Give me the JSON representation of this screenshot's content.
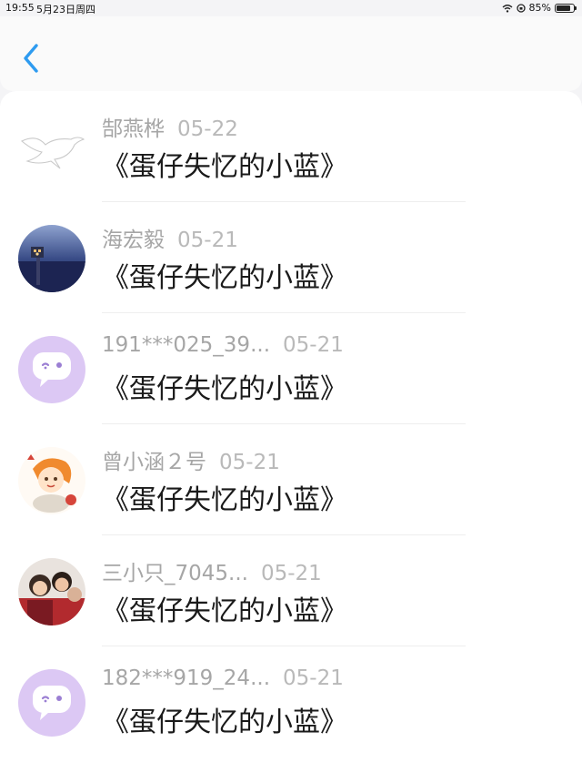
{
  "status_bar": {
    "time": "19:55",
    "date": "5月23日周四",
    "battery": "85%",
    "battery_level": 0.85
  },
  "header": {
    "back_icon": "chevron-left-icon"
  },
  "accent_color": "#2e9bf0",
  "items": [
    {
      "name": "郜燕桦",
      "date": "05-22",
      "message": "《蛋仔失忆的小蓝》",
      "avatar": "bird-outline-avatar"
    },
    {
      "name": "海宏毅",
      "date": "05-21",
      "message": "《蛋仔失忆的小蓝》",
      "avatar": "night-pier-photo-avatar"
    },
    {
      "name": "191***025_39...",
      "date": "05-21",
      "message": "《蛋仔失忆的小蓝》",
      "avatar": "default-chat-bubble-avatar"
    },
    {
      "name": "曾小涵２号",
      "date": "05-21",
      "message": "《蛋仔失忆的小蓝》",
      "avatar": "cartoon-girl-avatar"
    },
    {
      "name": "三小只_7045...",
      "date": "05-21",
      "message": "《蛋仔失忆的小蓝》",
      "avatar": "family-photo-avatar"
    },
    {
      "name": "182***919_24...",
      "date": "05-21",
      "message": "《蛋仔失忆的小蓝》",
      "avatar": "default-chat-bubble-avatar"
    }
  ]
}
